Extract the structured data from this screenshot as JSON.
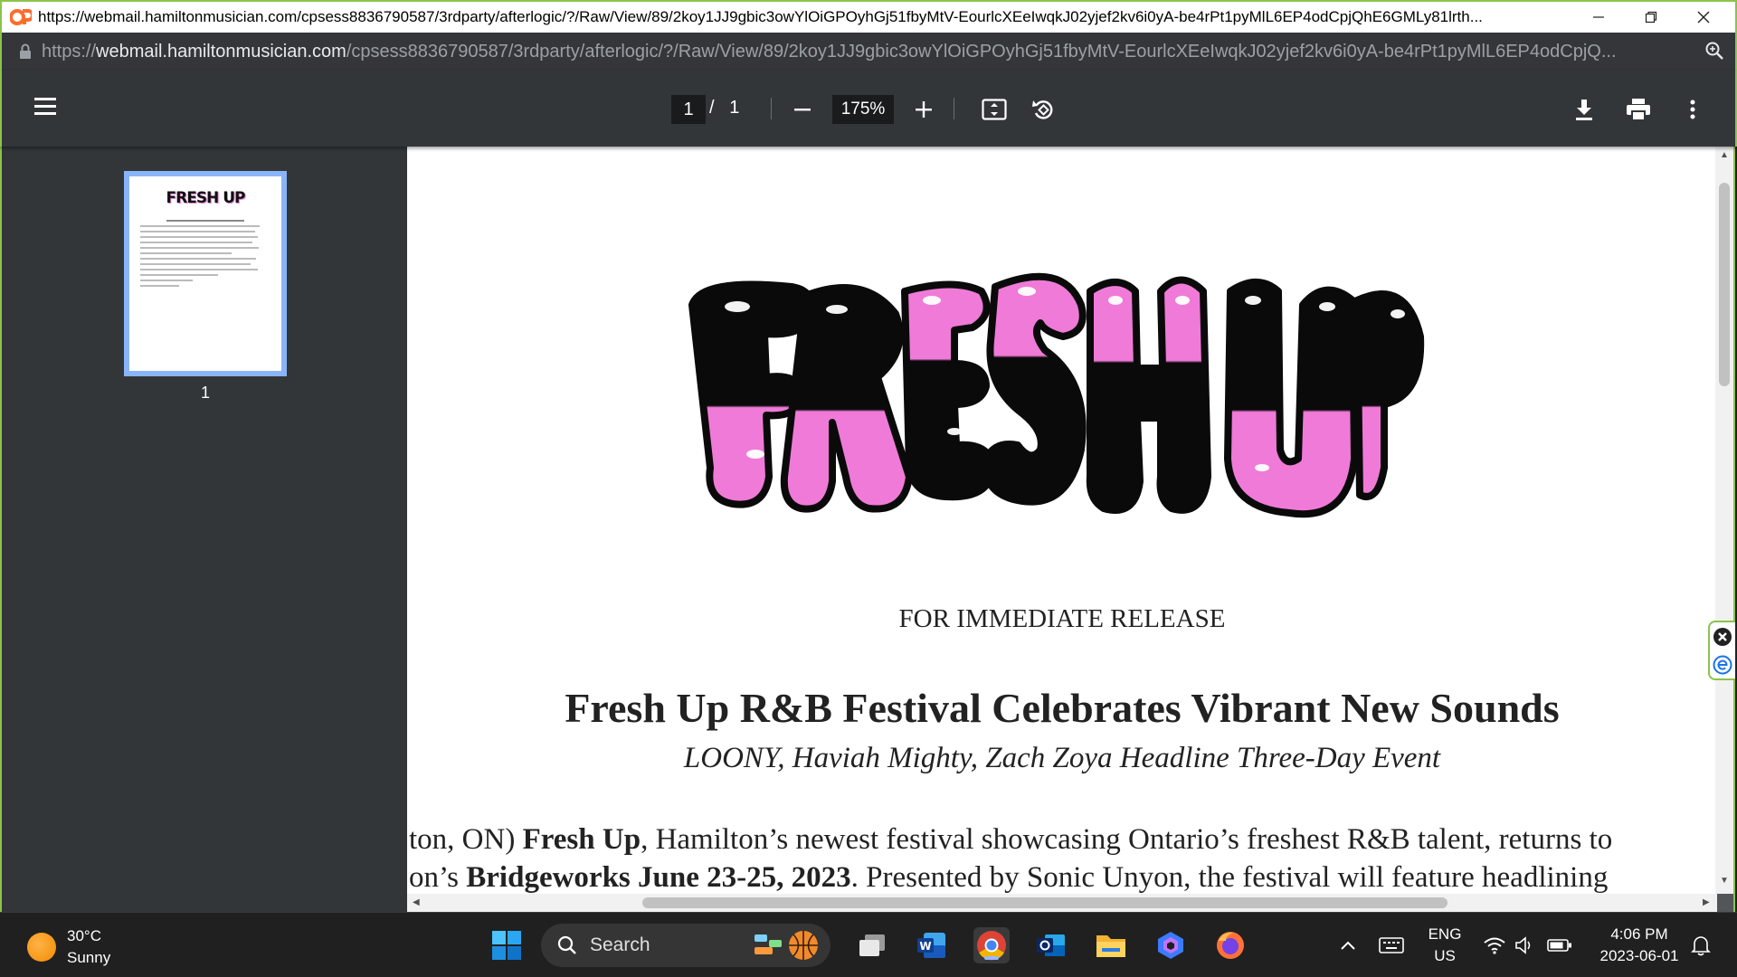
{
  "window": {
    "title": "https://webmail.hamiltonmusician.com/cpsess8836790587/3rdparty/afterlogic/?/Raw/View/89/2koy1JJ9gbic3owYlOiGPOyhGj51fbyMtV-EourlcXEeIwqkJ02yjef2kv6i0yA-be4rPt1pyMlL6EP4odCpjQhE6GMLy81lrth..."
  },
  "address": {
    "scheme": "https://",
    "host": "webmail.hamiltonmusician.com",
    "path": "/cpsess8836790587/3rdparty/afterlogic/?/Raw/View/89/2koy1JJ9gbic3owYlOiGPOyhGj51fbyMtV-EourlcXEeIwqkJ02yjef2kv6i0yA-be4rPt1pyMlL6EP4odCpjQ..."
  },
  "pdf_toolbar": {
    "current_page": "1",
    "page_separator": "/",
    "total_pages": "1",
    "zoom": "175%"
  },
  "sidebar": {
    "thumbnail_label": "1",
    "thumbnail_logo": "FRESH UP"
  },
  "document": {
    "logo_text": "FRESH UP",
    "release_label": "FOR IMMEDIATE RELEASE",
    "headline": "Fresh Up R&B Festival Celebrates Vibrant New Sounds",
    "subheadline": "LOONY, Haviah Mighty, Zach Zoya Headline Three-Day Event",
    "body_line1_a": "ton, ON) ",
    "body_line1_bold": "Fresh Up",
    "body_line1_b": ", Hamilton’s newest festival showcasing Ontario’s freshest R&B talent, returns to",
    "body_line2_a": "on’s ",
    "body_line2_bold": "Bridgeworks June 23-25, 2023",
    "body_line2_b": ". Presented by Sonic Unyon, the festival will feature headlining"
  },
  "taskbar": {
    "weather_temp": "30°C",
    "weather_desc": "Sunny",
    "search_label": "Search",
    "lang_line1": "ENG",
    "lang_line2": "US",
    "time": "4:06 PM",
    "date": "2023-06-01"
  },
  "colors": {
    "logo_pink": "#f07ad8",
    "logo_black": "#0a0a0a",
    "accent_border": "#8bc34a"
  }
}
